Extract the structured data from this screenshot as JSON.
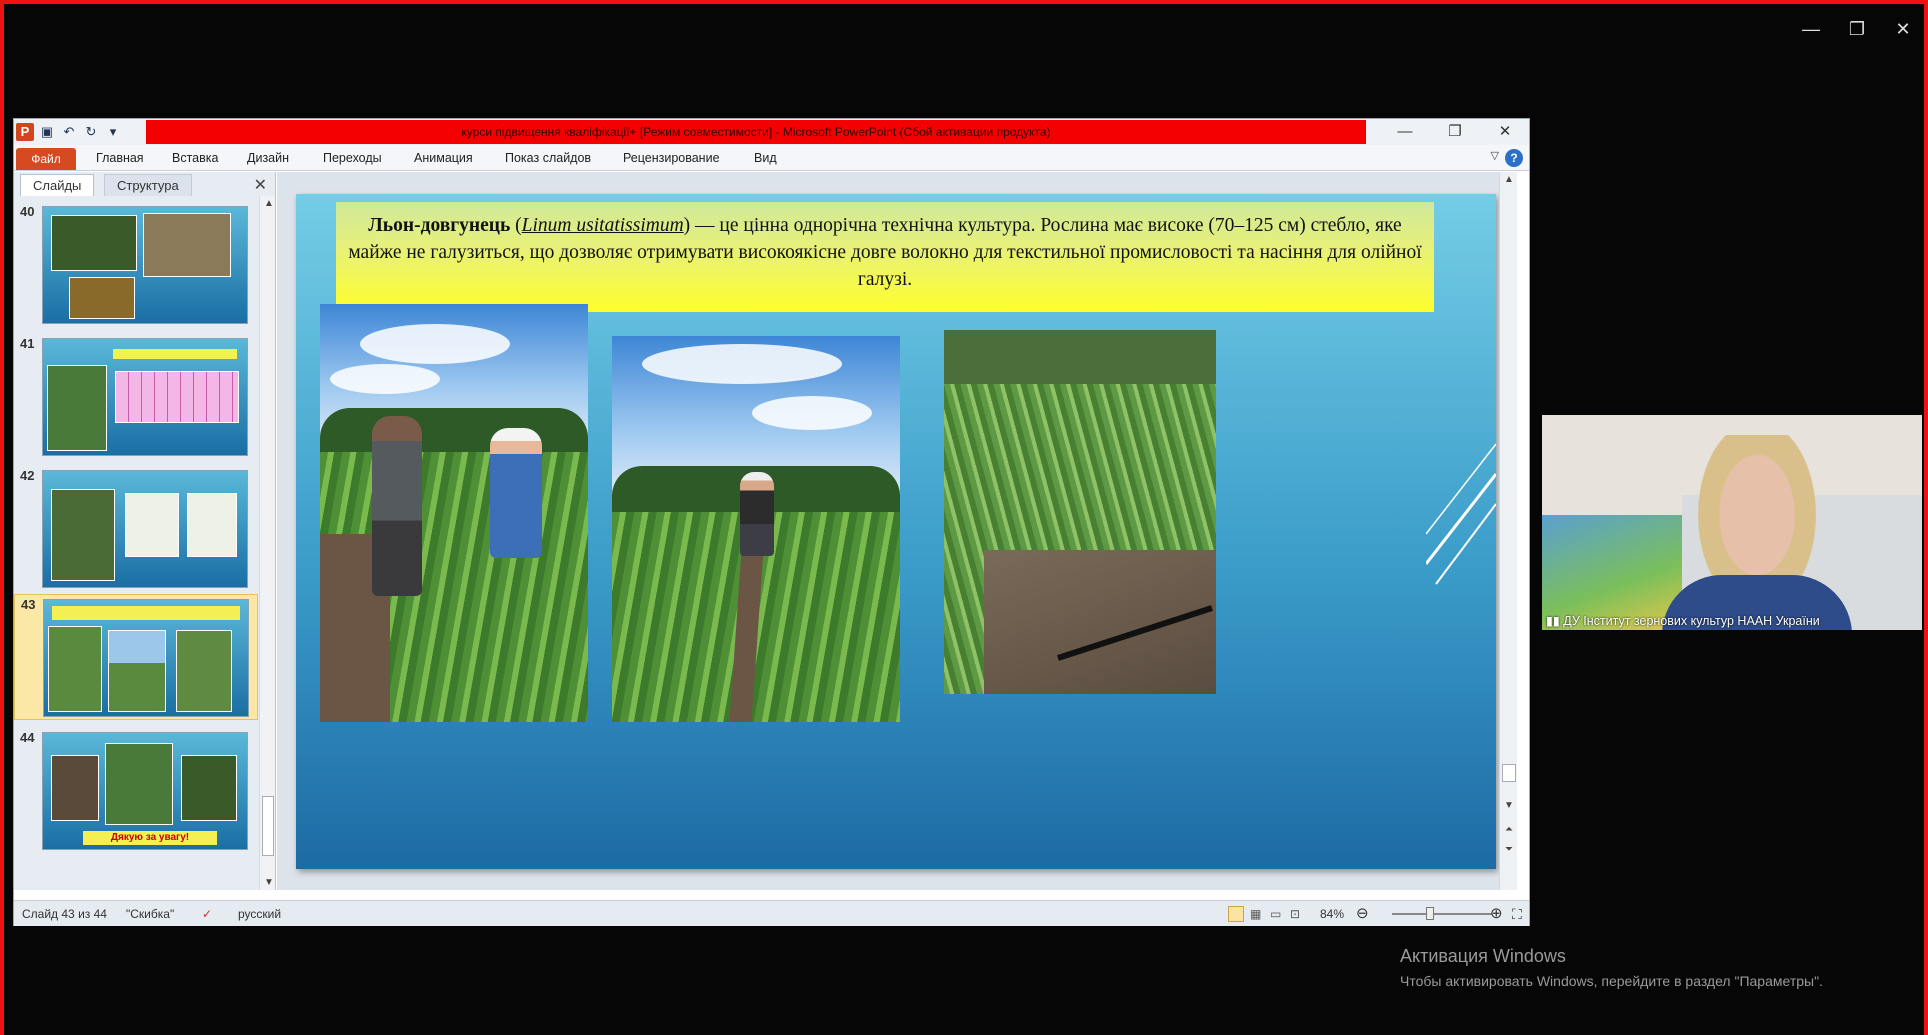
{
  "outer_window": {
    "minimize": "—",
    "restore": "❐",
    "close": "✕"
  },
  "titlebar": {
    "title": "курси підвищення кваліфікації+ [Режим совместимости]  -  Microsoft PowerPoint (Сбой активации продукта)",
    "icons": [
      "powerpoint-logo",
      "save-icon",
      "undo-icon",
      "redo-icon",
      "customize-icon"
    ],
    "app_letter": "P"
  },
  "ribbon": {
    "file": "Файл",
    "tabs": [
      "Главная",
      "Вставка",
      "Дизайн",
      "Переходы",
      "Анимация",
      "Показ слайдов",
      "Рецензирование",
      "Вид"
    ],
    "help": "?"
  },
  "panel": {
    "tab_slides": "Слайды",
    "tab_outline": "Структура",
    "close": "✕",
    "slides": [
      {
        "number": "40"
      },
      {
        "number": "41"
      },
      {
        "number": "42"
      },
      {
        "number": "43"
      },
      {
        "number": "44",
        "caption": "Дякую за увагу!"
      }
    ]
  },
  "slide": {
    "banner_bold": "Льон-довгунець",
    "banner_latin": "Linum usitatissimum",
    "banner_rest": "— це цінна однорічна технічна культура. Рослина має високе (70–125 см) стебло, яке майже не галузиться, що дозволяє отримувати високоякісне довге волокно для текстильної промисловості та насіння для олійної галузі."
  },
  "status": {
    "slide_info": "Слайд 43 из 44",
    "theme": "\"Скибка\"",
    "language": "русский",
    "zoom": "84%"
  },
  "webcam": {
    "label": "ДУ Інститут зернових культур НААН України"
  },
  "activation": {
    "title": "Активация Windows",
    "subtitle": "Чтобы активировать Windows, перейдите в раздел \"Параметры\"."
  },
  "colors": {
    "title_bar_red": "#f40000",
    "file_tab": "#d64a22",
    "slide_banner_yellow": "#ffff2c",
    "slide_bg": "#3b9cc9"
  }
}
